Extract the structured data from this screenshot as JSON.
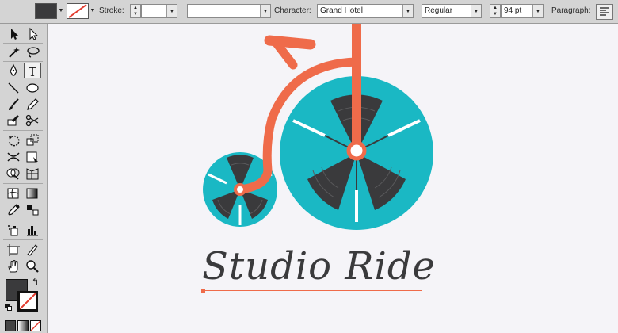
{
  "controlbar": {
    "stroke_label": "Stroke:",
    "stroke_value": "",
    "variable_width_value": "",
    "character_label": "Character:",
    "font_family": "Grand Hotel",
    "font_style": "Regular",
    "font_size": "94 pt",
    "paragraph_label": "Paragraph:"
  },
  "tools": [
    "selection-tool",
    "direct-selection-tool",
    "magic-wand-tool",
    "lasso-tool",
    "pen-tool",
    "type-tool",
    "line-segment-tool",
    "ellipse-tool",
    "paintbrush-tool",
    "pencil-tool",
    "blob-brush-tool",
    "scissors-tool",
    "rotate-tool",
    "scale-tool",
    "width-tool",
    "free-transform-tool",
    "shape-builder-tool",
    "perspective-grid-tool",
    "mesh-tool",
    "gradient-tool",
    "eyedropper-tool",
    "blend-tool",
    "symbol-sprayer-tool",
    "column-graph-tool",
    "artboard-tool",
    "slice-tool",
    "hand-tool",
    "zoom-tool"
  ],
  "colors": {
    "fill": "#3a3a3c",
    "accent_orange": "#ef6b4a",
    "teal": "#1ab8c4",
    "dark": "#3a3a3c",
    "artboard": "#f5f4f8"
  },
  "artwork": {
    "logo_text": "Studio Ride"
  }
}
